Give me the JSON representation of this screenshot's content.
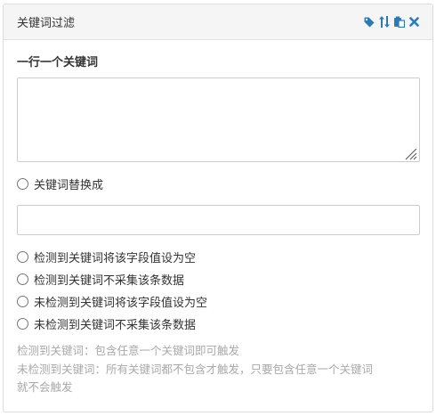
{
  "panel": {
    "title": "关键词过滤",
    "icons": [
      "tag-icon",
      "sort-icon",
      "paste-icon",
      "close-icon"
    ]
  },
  "keywords": {
    "label": "一行一个关键词",
    "value": "",
    "placeholder": ""
  },
  "replace": {
    "label": "关键词替换成",
    "value": "",
    "placeholder": ""
  },
  "options": [
    "检测到关键词将该字段值设为空",
    "检测到关键词不采集该条数据",
    "未检测到关键词将该字段值设为空",
    "未检测到关键词不采集该条数据"
  ],
  "help": {
    "line1": "检测到关键词：包含任意一个关键词即可触发",
    "line2": "未检测到关键词：所有关键词都不包含才触发，只要包含任意一个关键词",
    "line3": "就不会触发"
  },
  "colors": {
    "icon": "#2a7ab8",
    "help_text": "#a9a9a9",
    "header_bg": "#f5f5f5"
  }
}
